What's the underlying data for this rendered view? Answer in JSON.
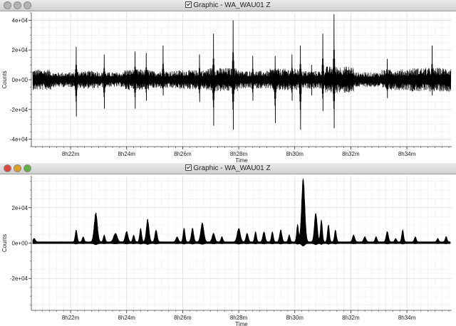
{
  "windows": [
    {
      "title": "Graphic - WA_WAU01 Z",
      "traffic_colors": [
        "#b4b4b4",
        "#b4b4b4",
        "#b4b4b4"
      ]
    },
    {
      "title": "Graphic - WA_WAU01 Z",
      "traffic_colors": [
        "#e0443e",
        "#dea123",
        "#5fb343"
      ]
    }
  ],
  "chart_data": [
    {
      "type": "line",
      "title": "",
      "xlabel": "Time",
      "ylabel": "Counts",
      "ylim": [
        -45000,
        45000
      ],
      "yticks": [
        -40000,
        -20000,
        0,
        20000,
        40000
      ],
      "ytick_labels": [
        "-4e+04",
        "-2e+04",
        "0e+00",
        "2e+04",
        "4e+04"
      ],
      "xlim": [
        500.6,
        515.6
      ],
      "xticks": [
        502,
        504,
        506,
        508,
        510,
        512,
        514
      ],
      "xtick_labels": [
        "8h22m",
        "8h24m",
        "8h26m",
        "8h28m",
        "8h30m",
        "8h32m",
        "8h34m"
      ],
      "grid": true,
      "color": "#000000",
      "background": 5500,
      "envelope": [
        {
          "x": 500.8,
          "a": 7000
        },
        {
          "x": 501.8,
          "a": 5000
        },
        {
          "x": 502.6,
          "a": 6000
        },
        {
          "x": 503.4,
          "a": 5000
        },
        {
          "x": 504.4,
          "a": 7000
        },
        {
          "x": 505.3,
          "a": 6000
        },
        {
          "x": 506.3,
          "a": 6500
        },
        {
          "x": 507.4,
          "a": 8000
        },
        {
          "x": 508.6,
          "a": 6000
        },
        {
          "x": 509.6,
          "a": 7500
        },
        {
          "x": 510.6,
          "a": 6000
        },
        {
          "x": 511.6,
          "a": 9000
        },
        {
          "x": 512.6,
          "a": 5000
        },
        {
          "x": 513.6,
          "a": 7000
        },
        {
          "x": 514.6,
          "a": 8000
        }
      ],
      "spikes": [
        {
          "x": 502.2,
          "up": 22000,
          "down": -28000
        },
        {
          "x": 503.2,
          "up": 17000,
          "down": -22000
        },
        {
          "x": 504.3,
          "up": 19000,
          "down": -22000
        },
        {
          "x": 504.7,
          "up": 18000,
          "down": -16000
        },
        {
          "x": 505.3,
          "up": 23000,
          "down": -12000
        },
        {
          "x": 506.6,
          "up": 17000,
          "down": -17000
        },
        {
          "x": 507.1,
          "up": 31000,
          "down": -35000
        },
        {
          "x": 507.8,
          "up": 40000,
          "down": -38000
        },
        {
          "x": 508.5,
          "up": 16000,
          "down": -16000
        },
        {
          "x": 509.3,
          "up": 16000,
          "down": -33000
        },
        {
          "x": 509.9,
          "up": 17000,
          "down": -16000
        },
        {
          "x": 510.2,
          "up": 23000,
          "down": -38000
        },
        {
          "x": 510.6,
          "up": 10000,
          "down": -12000
        },
        {
          "x": 511.0,
          "up": 31000,
          "down": -24000
        },
        {
          "x": 511.4,
          "up": 44000,
          "down": -37000
        },
        {
          "x": 513.3,
          "up": 14000,
          "down": -14000
        },
        {
          "x": 514.9,
          "up": 23000,
          "down": -12000
        }
      ]
    },
    {
      "type": "area",
      "title": "",
      "xlabel": "Time",
      "ylabel": "Counts",
      "ylim": [
        -38000,
        38000
      ],
      "yticks": [
        -20000,
        0,
        20000
      ],
      "ytick_labels": [
        "-2e+04",
        "0e+00",
        "2e+04"
      ],
      "xlim": [
        500.6,
        515.6
      ],
      "xticks": [
        502,
        504,
        506,
        508,
        510,
        512,
        514
      ],
      "xtick_labels": [
        "8h22m",
        "8h24m",
        "8h26m",
        "8h28m",
        "8h30m",
        "8h32m",
        "8h34m"
      ],
      "grid": true,
      "color": "#000000",
      "baseline": 800,
      "peaks": [
        {
          "x": 500.7,
          "v": 2000,
          "w": 0.06
        },
        {
          "x": 502.2,
          "v": 7000,
          "w": 0.05
        },
        {
          "x": 502.45,
          "v": 3000,
          "w": 0.05
        },
        {
          "x": 502.9,
          "v": 17000,
          "w": 0.08
        },
        {
          "x": 503.2,
          "v": 4000,
          "w": 0.05
        },
        {
          "x": 503.6,
          "v": 5000,
          "w": 0.09
        },
        {
          "x": 504.0,
          "v": 6000,
          "w": 0.07
        },
        {
          "x": 504.25,
          "v": 4000,
          "w": 0.05
        },
        {
          "x": 504.5,
          "v": 8000,
          "w": 0.05
        },
        {
          "x": 504.75,
          "v": 13000,
          "w": 0.07
        },
        {
          "x": 505.05,
          "v": 7000,
          "w": 0.06
        },
        {
          "x": 505.8,
          "v": 3000,
          "w": 0.06
        },
        {
          "x": 506.05,
          "v": 8000,
          "w": 0.05
        },
        {
          "x": 506.35,
          "v": 8000,
          "w": 0.06
        },
        {
          "x": 506.7,
          "v": 11000,
          "w": 0.08
        },
        {
          "x": 507.1,
          "v": 5000,
          "w": 0.07
        },
        {
          "x": 507.4,
          "v": 3000,
          "w": 0.05
        },
        {
          "x": 508.0,
          "v": 8000,
          "w": 0.08
        },
        {
          "x": 508.3,
          "v": 5000,
          "w": 0.06
        },
        {
          "x": 508.6,
          "v": 6000,
          "w": 0.05
        },
        {
          "x": 508.9,
          "v": 6000,
          "w": 0.06
        },
        {
          "x": 509.2,
          "v": 6000,
          "w": 0.05
        },
        {
          "x": 509.5,
          "v": 7000,
          "w": 0.06
        },
        {
          "x": 509.8,
          "v": 4000,
          "w": 0.05
        },
        {
          "x": 510.1,
          "v": 10000,
          "w": 0.05
        },
        {
          "x": 510.3,
          "v": 38000,
          "w": 0.08
        },
        {
          "x": 510.75,
          "v": 17000,
          "w": 0.07
        },
        {
          "x": 510.95,
          "v": 13000,
          "w": 0.05
        },
        {
          "x": 511.2,
          "v": 10000,
          "w": 0.05
        },
        {
          "x": 511.45,
          "v": 7000,
          "w": 0.05
        },
        {
          "x": 512.1,
          "v": 4000,
          "w": 0.06
        },
        {
          "x": 512.5,
          "v": 3000,
          "w": 0.06
        },
        {
          "x": 512.9,
          "v": 3000,
          "w": 0.05
        },
        {
          "x": 513.3,
          "v": 6000,
          "w": 0.06
        },
        {
          "x": 513.6,
          "v": 2000,
          "w": 0.05
        },
        {
          "x": 513.85,
          "v": 7000,
          "w": 0.05
        },
        {
          "x": 514.3,
          "v": 3000,
          "w": 0.05
        },
        {
          "x": 515.1,
          "v": 2000,
          "w": 0.05
        },
        {
          "x": 515.4,
          "v": 3000,
          "w": 0.05
        }
      ]
    }
  ]
}
